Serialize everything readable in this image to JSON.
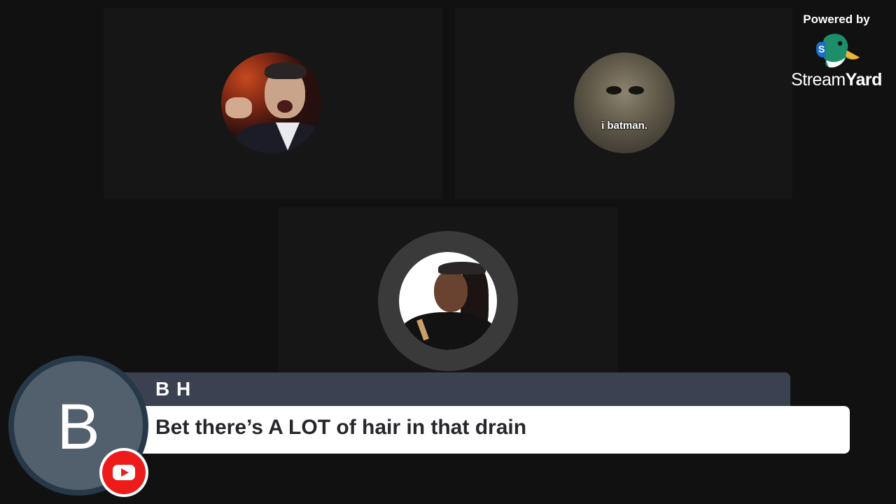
{
  "branding": {
    "powered_by": "Powered by",
    "brand_name_part1": "Stream",
    "brand_name_part2": "Yard",
    "logo_icon": "duck-logo-icon"
  },
  "participants": [
    {
      "id": "participant-1",
      "avatar_caption": ""
    },
    {
      "id": "participant-2",
      "avatar_caption": "i batman."
    },
    {
      "id": "participant-3",
      "avatar_caption": ""
    }
  ],
  "comment": {
    "avatar_letter": "B",
    "author": "B H",
    "text": "Bet there’s A LOT of hair in that drain",
    "platform_icon": "youtube-icon"
  },
  "colors": {
    "background": "#111111",
    "tile": "#161616",
    "name_bar": "#3b4150",
    "youtube_red": "#ee1b1b"
  }
}
